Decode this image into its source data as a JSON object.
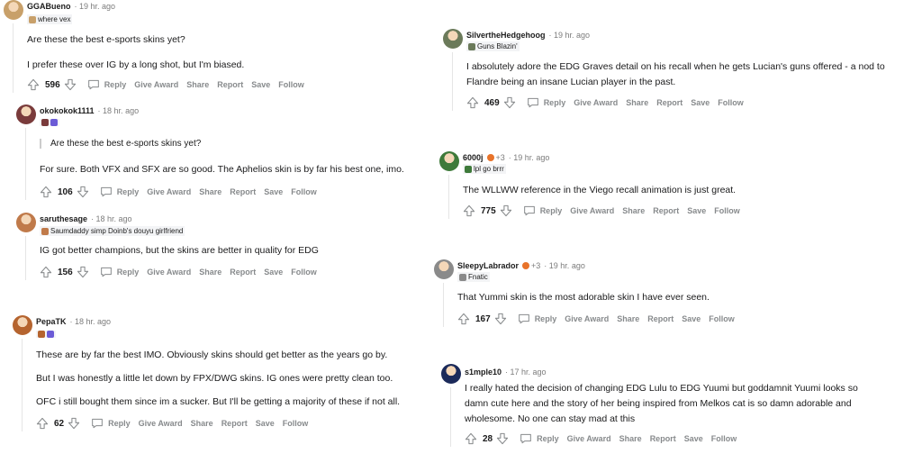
{
  "comments": [
    {
      "author": "GGABueno",
      "time": "· 19 hr. ago",
      "flair": "where vex",
      "lines": [
        "Are these the best e-sports skins yet?",
        "I prefer these over IG by a long shot, but I'm biased."
      ],
      "votes": "596",
      "accent": "#c8a06a"
    },
    {
      "author": "okokokok1111",
      "time": "· 18 hr. ago",
      "flair": "",
      "quote": "Are these the best e-sports skins yet?",
      "lines": [
        "For sure. Both VFX and SFX are so good. The Aphelios skin is by far his best one, imo."
      ],
      "votes": "106",
      "accent": "#7a3b3b"
    },
    {
      "author": "saruthesage",
      "time": "· 18 hr. ago",
      "flair": "Saumdaddy simp  Doinb's douyu girlfriend",
      "lines": [
        "IG got better champions, but the skins are better in quality for EDG"
      ],
      "votes": "156",
      "accent": "#c07a4a"
    },
    {
      "author": "PepaTK",
      "time": "· 18 hr. ago",
      "flair": "",
      "lines": [
        "These are by far the best IMO. Obviously skins should get better as the years go by.",
        "But I was honestly a little let down by FPX/DWG skins. IG ones were pretty clean too.",
        "OFC i still bought them since im a sucker. But I'll be getting a majority of these if not all."
      ],
      "votes": "62",
      "accent": "#b5642f"
    },
    {
      "author": "SilvertheHedgehoog",
      "time": "· 19 hr. ago",
      "flair": "Guns Blazin'",
      "lines": [
        "I absolutely adore the EDG Graves detail on his recall when he gets Lucian's guns offered - a nod to",
        "Flandre being an insane Lucian player in the past."
      ],
      "votes": "469",
      "accent": "#6b7a5a"
    },
    {
      "author": "6000j",
      "time": "· 19 hr. ago",
      "plus": "+3",
      "flair": "lpl go brrr",
      "lines": [
        "The WLLWW reference in the Viego recall animation is just great."
      ],
      "votes": "775",
      "accent": "#3e7a3a"
    },
    {
      "author": "SleepyLabrador",
      "time": "· 19 hr. ago",
      "plus": "+3",
      "flair": "Fnatic",
      "lines": [
        "That Yummi skin is the most adorable skin I have ever seen."
      ],
      "votes": "167",
      "accent": "#8a8a8a"
    },
    {
      "author": "s1mple10",
      "time": "· 17 hr. ago",
      "flair": "",
      "lines": [
        "I really hated the decision of changing EDG Lulu to EDG Yuumi but goddamnit Yuumi looks so",
        "damn cute here and the story of her being inspired from Melkos cat is so damn adorable and",
        "wholesome. No one can stay mad at this"
      ],
      "votes": "28",
      "accent": "#1b2a5a"
    }
  ],
  "actions": {
    "reply": "Reply",
    "give_award": "Give Award",
    "share": "Share",
    "report": "Report",
    "save": "Save",
    "follow": "Follow"
  },
  "colors": {
    "text": "#1a1a1b",
    "meta": "#878a8c",
    "threadline": "#e5e5e5"
  }
}
